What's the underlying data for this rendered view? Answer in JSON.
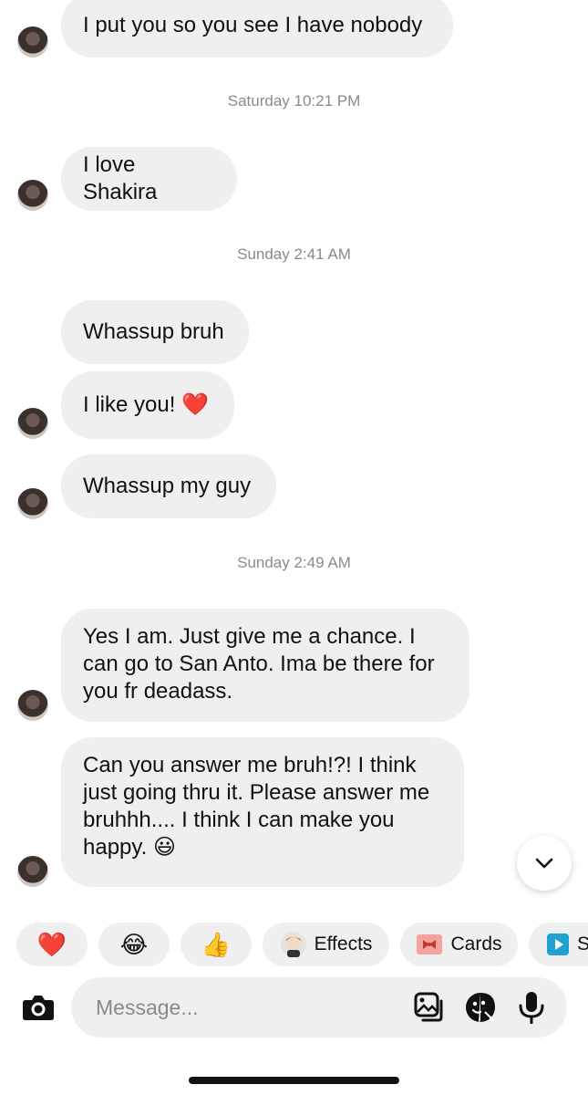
{
  "messages": [
    {
      "text": "I put you so you see I have nobody"
    },
    {
      "timestamp": "Saturday 10:21 PM"
    },
    {
      "text": "I love Shakira"
    },
    {
      "timestamp": "Sunday 2:41 AM"
    },
    {
      "text": "Whassup bruh"
    },
    {
      "text": "I like you! ❤️"
    },
    {
      "text": "Whassup my guy"
    },
    {
      "timestamp": "Sunday 2:49 AM"
    },
    {
      "lines": [
        "Yes I am. Just give me a chance. I",
        "can go to San Anto. Ima be there for",
        "you fr deadass."
      ]
    },
    {
      "lines": [
        "Can you answer me bruh!?! I think",
        "just going thru it. Please answer me",
        "bruhhh....  I think I can make you",
        "happy. 😃"
      ]
    }
  ],
  "quick_actions": {
    "heart": "❤️",
    "laugh": "😂",
    "thumbs_up": "👍",
    "effects": "Effects",
    "cards": "Cards",
    "partial": "S"
  },
  "composer": {
    "placeholder": "Message..."
  },
  "icons": [
    "camera-icon",
    "gallery-icon",
    "sticker-icon",
    "microphone-icon",
    "chevron-down-icon",
    "effects-avatar-icon",
    "cards-ribbon-icon",
    "play-icon"
  ],
  "colors": {
    "bubble": "#efefef",
    "timestamp": "#8a8a8a",
    "text": "#111111",
    "cards_icon": "#f4a3a0",
    "play_icon": "#1ea0d0"
  }
}
